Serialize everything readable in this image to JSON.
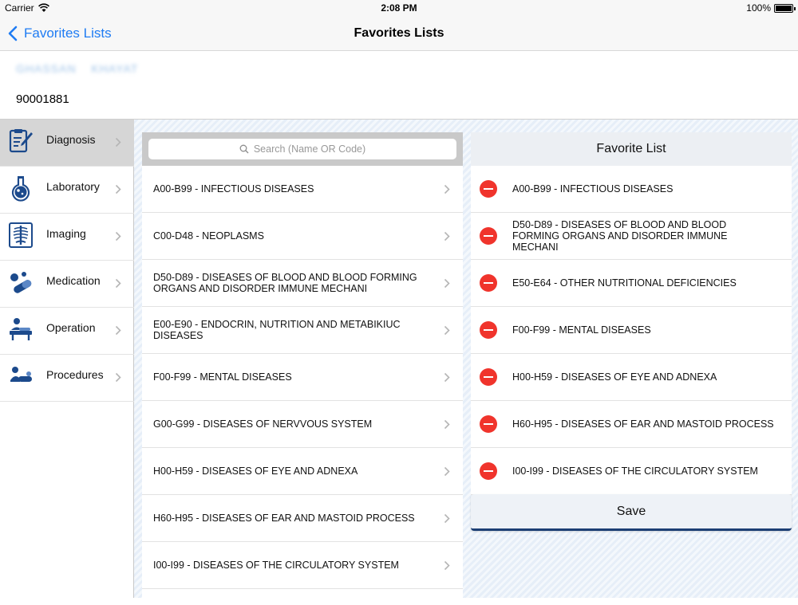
{
  "status_bar": {
    "carrier": "Carrier",
    "time": "2:08 PM",
    "battery": "100%"
  },
  "nav": {
    "back_label": "Favorites Lists",
    "title": "Favorites Lists"
  },
  "patient": {
    "name": "GHASSAN KHAYAT",
    "id": "90001881"
  },
  "sidebar": {
    "items": [
      {
        "label": "Diagnosis",
        "icon": "clipboard-pencil-icon",
        "active": true
      },
      {
        "label": "Laboratory",
        "icon": "flask-icon",
        "active": false
      },
      {
        "label": "Imaging",
        "icon": "xray-skeleton-icon",
        "active": false
      },
      {
        "label": "Medication",
        "icon": "pills-icon",
        "active": false
      },
      {
        "label": "Operation",
        "icon": "surgeon-icon",
        "active": false
      },
      {
        "label": "Procedures",
        "icon": "patient-procedure-icon",
        "active": false
      }
    ]
  },
  "search": {
    "placeholder": "Search (Name OR Code)"
  },
  "categories": [
    "A00-B99 - INFECTIOUS  DISEASES",
    "C00-D48 - NEOPLASMS",
    "D50-D89 - DISEASES OF BLOOD AND BLOOD FORMING ORGANS AND DISORDER IMMUNE MECHANI",
    "E00-E90 - ENDOCRIN, NUTRITION AND METABIKIUC DISEASES",
    "F00-F99 - MENTAL  DISEASES",
    "G00-G99 - DISEASES OF NERVVOUS SYSTEM",
    "H00-H59 - DISEASES OF EYE AND ADNEXA",
    "H60-H95 - DISEASES OF EAR AND MASTOID PROCESS",
    "I00-I99 - DISEASES OF THE CIRCULATORY SYSTEM"
  ],
  "favorites": {
    "title": "Favorite List",
    "items": [
      "A00-B99 - INFECTIOUS  DISEASES",
      "D50-D89 - DISEASES OF BLOOD AND BLOOD FORMING ORGANS AND DISORDER IMMUNE MECHANI",
      "E50-E64 - OTHER NUTRITIONAL DEFICIENCIES",
      "F00-F99 - MENTAL  DISEASES",
      "H00-H59 - DISEASES OF EYE AND ADNEXA",
      "H60-H95 - DISEASES OF EAR AND MASTOID PROCESS",
      "I00-I99 - DISEASES OF THE CIRCULATORY SYSTEM"
    ],
    "save_label": "Save"
  },
  "colors": {
    "accent": "#1f7cf3",
    "icon_blue": "#1c4a8c",
    "remove_red": "#f0342c",
    "save_border": "#1c3f74"
  }
}
